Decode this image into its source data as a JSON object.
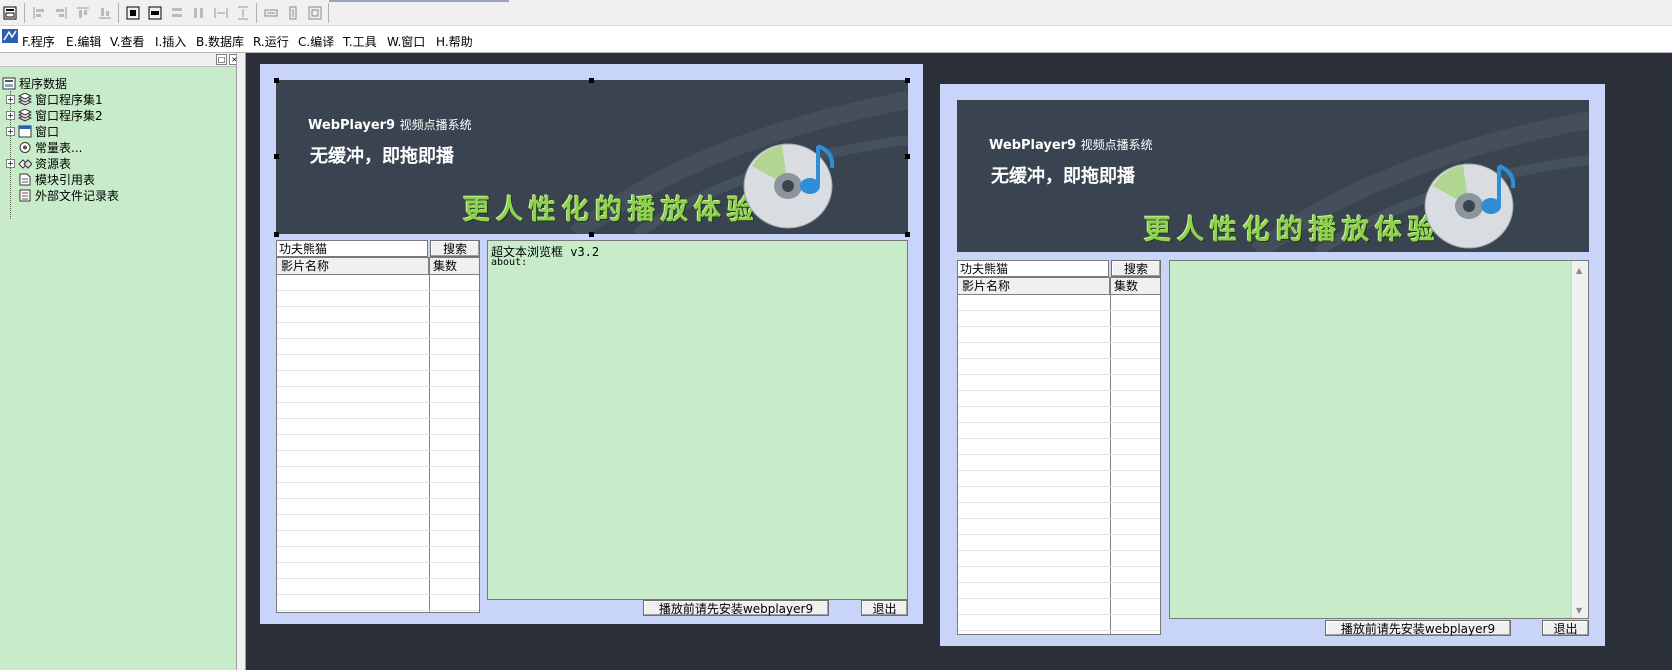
{
  "menubar": {
    "items": [
      "F.程序",
      "E.编辑",
      "V.查看",
      "I.插入",
      "B.数据库",
      "R.运行",
      "C.编译",
      "T.工具",
      "W.窗口",
      "H.帮助"
    ]
  },
  "tree": {
    "root": "程序数据",
    "items": [
      "窗口程序集1",
      "窗口程序集2",
      "窗口",
      "常量表...",
      "资源表",
      "模块引用表",
      "外部文件记录表"
    ]
  },
  "design_window": {
    "banner_brand": "WebPlayer9",
    "banner_brand_sub": "视频点播系统",
    "banner_tagline": "无缓冲，即拖即播",
    "banner_slogan": "更人性化的播放体验",
    "search_value": "功夫熊猫",
    "search_button": "搜索",
    "col_name": "影片名称",
    "col_episodes": "集数",
    "browser_title": "超文本浏览框 v3.2",
    "browser_text": "about:",
    "install_button": "播放前请先安装webplayer9",
    "exit_button": "退出"
  },
  "preview_window": {
    "banner_brand": "WebPlayer9",
    "banner_brand_sub": "视频点播系统",
    "banner_tagline": "无缓冲，即拖即播",
    "banner_slogan": "更人性化的播放体验",
    "search_value": "功夫熊猫",
    "search_button": "搜索",
    "col_name": "影片名称",
    "col_episodes": "集数",
    "install_button": "播放前请先安装webplayer9",
    "exit_button": "退出"
  }
}
